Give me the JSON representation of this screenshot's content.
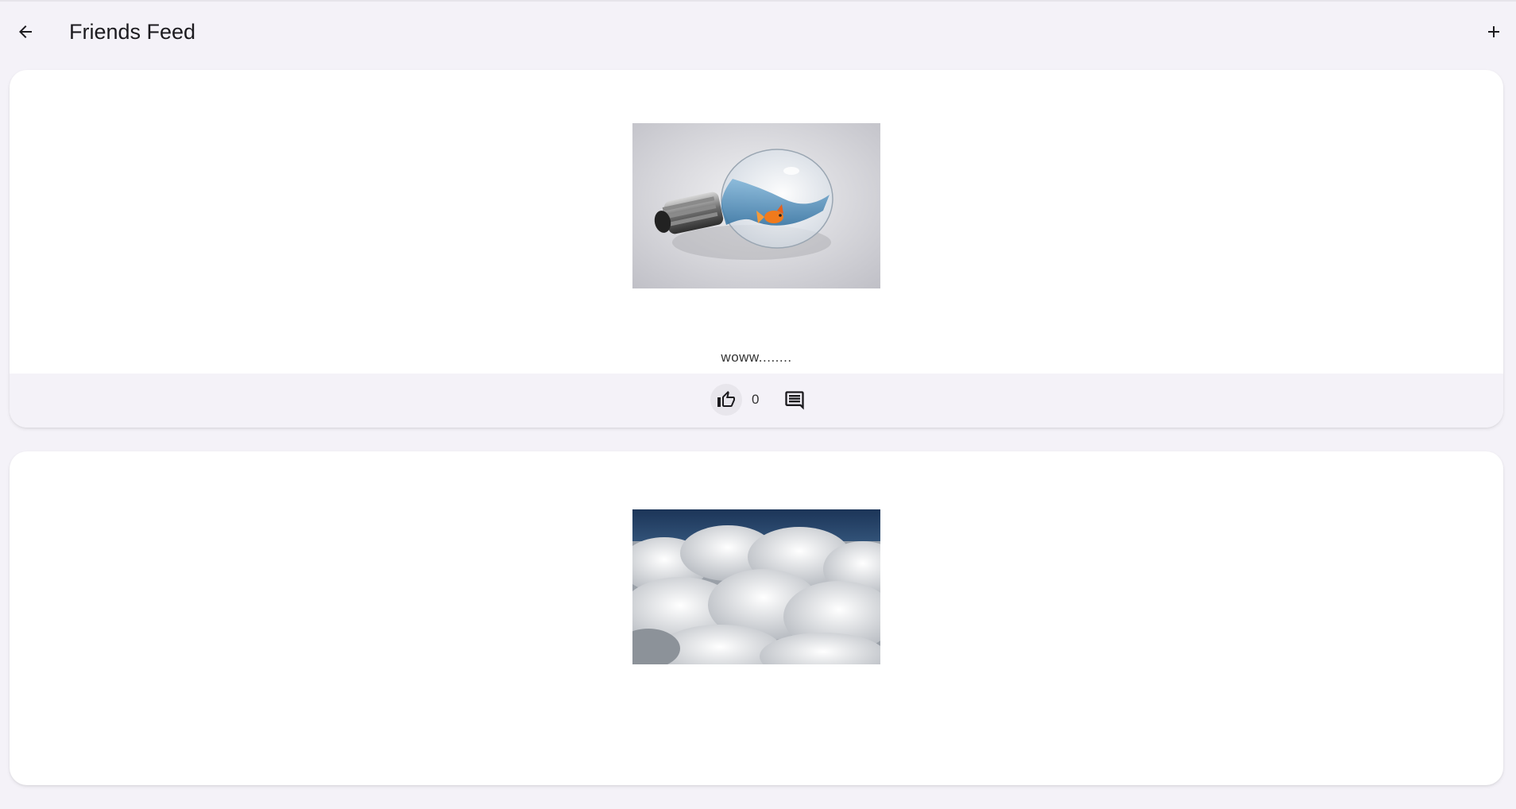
{
  "app_bar": {
    "title": "Friends Feed",
    "back_icon": "arrow-back-icon",
    "add_icon": "plus-icon"
  },
  "feed": {
    "posts": [
      {
        "image": "lightbulb-goldfish-photo",
        "caption": "woww........",
        "like_count": "0",
        "like_icon": "thumb-up-icon",
        "comment_icon": "comment-icon"
      },
      {
        "image": "clouds-photo"
      }
    ]
  },
  "colors": {
    "background": "#f4f2f8",
    "card": "#ffffff",
    "text": "#1c1b1f"
  }
}
